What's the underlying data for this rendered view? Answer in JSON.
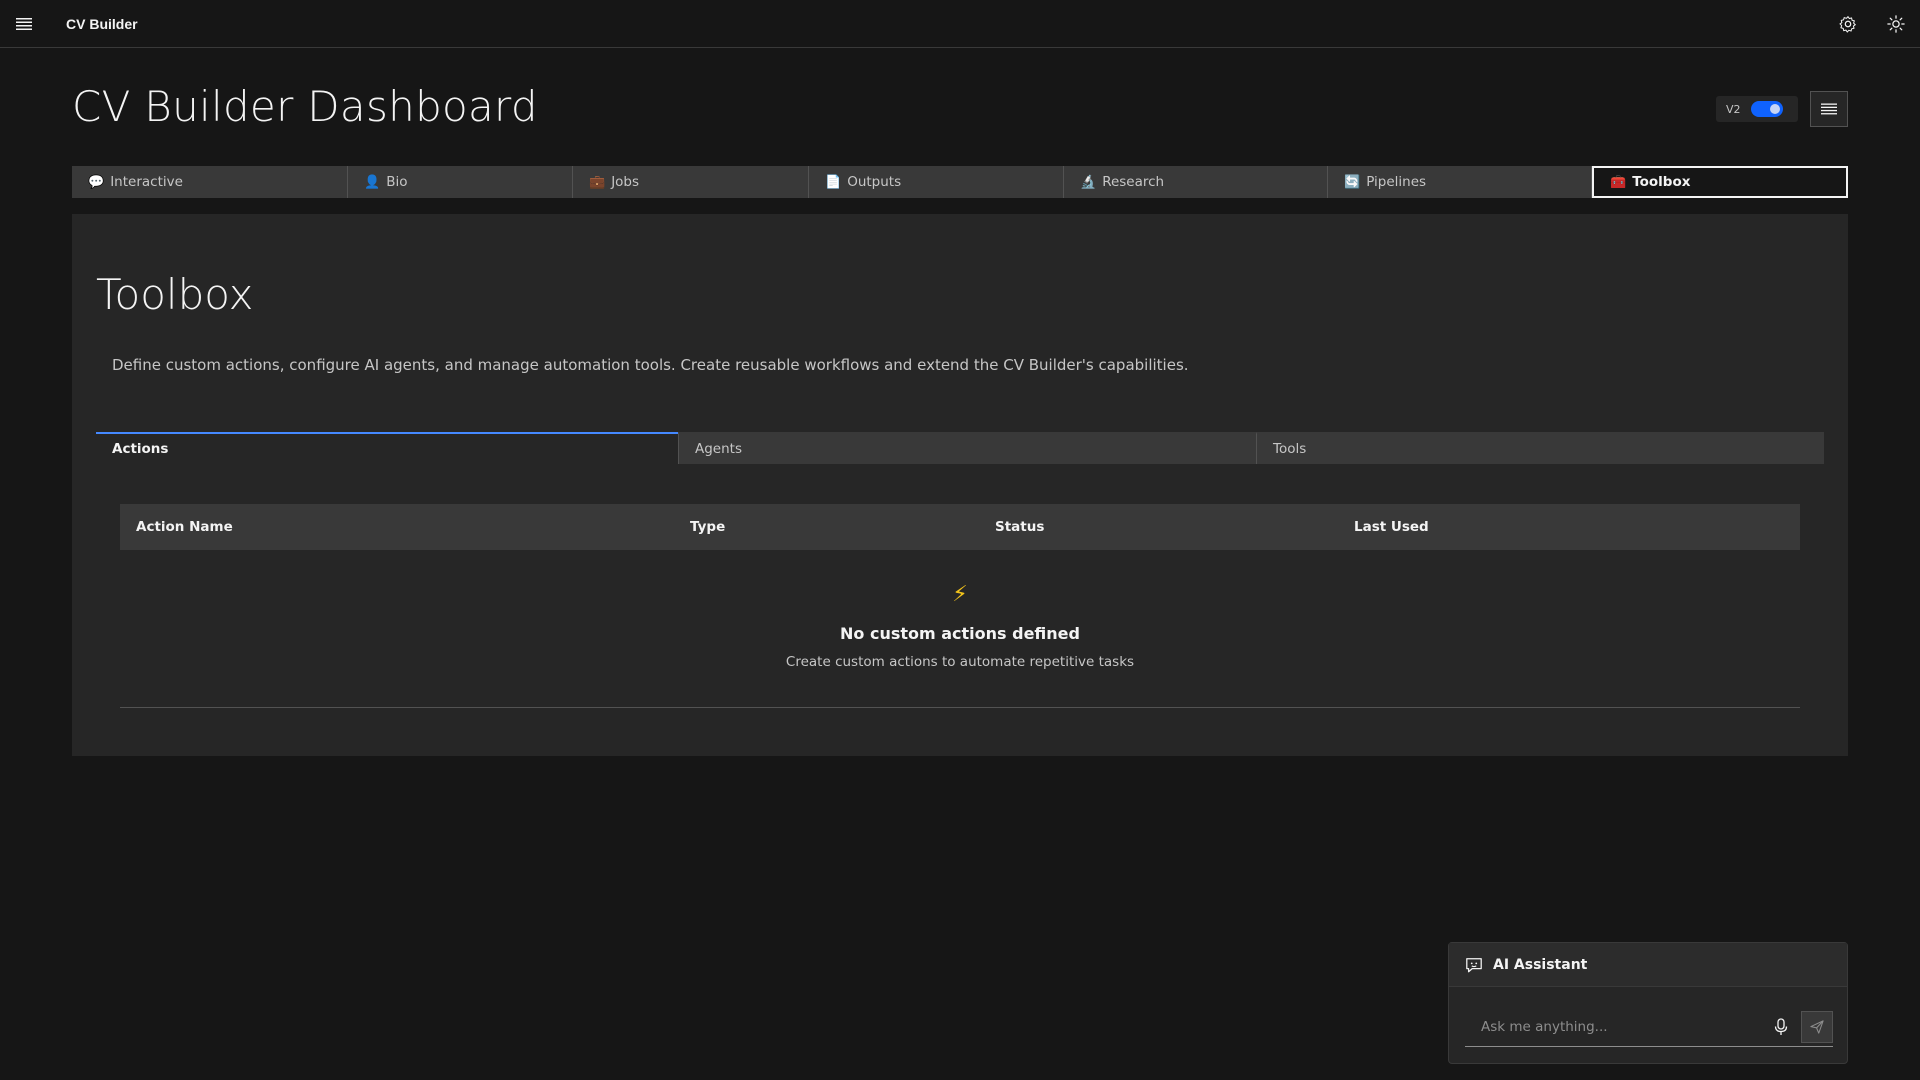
{
  "header": {
    "app_name": "CV Builder",
    "icons": [
      "menu-icon",
      "settings-icon",
      "theme-sun-icon"
    ]
  },
  "page": {
    "title": "CV Builder Dashboard",
    "version_label": "V2",
    "version_enabled": true
  },
  "main_tabs": [
    {
      "emoji": "💬",
      "label": "Interactive"
    },
    {
      "emoji": "👤",
      "label": "Bio"
    },
    {
      "emoji": "💼",
      "label": "Jobs"
    },
    {
      "emoji": "📄",
      "label": "Outputs"
    },
    {
      "emoji": "🔬",
      "label": "Research"
    },
    {
      "emoji": "🔄",
      "label": "Pipelines"
    },
    {
      "emoji": "🧰",
      "label": "Toolbox"
    }
  ],
  "active_main_tab": "Toolbox",
  "toolbox": {
    "title": "Toolbox",
    "description": "Define custom actions, configure AI agents, and manage automation tools. Create reusable workflows and extend the CV Builder's capabilities.",
    "sub_tabs": [
      "Actions",
      "Agents",
      "Tools"
    ],
    "active_sub_tab": "Actions",
    "table": {
      "columns": [
        "Action Name",
        "Type",
        "Status",
        "Last Used"
      ],
      "rows": []
    },
    "empty_state": {
      "icon": "⚡",
      "title": "No custom actions defined",
      "subtitle": "Create custom actions to automate repetitive tasks"
    }
  },
  "assistant": {
    "title": "AI Assistant",
    "placeholder": "Ask me anything..."
  },
  "colors": {
    "background": "#161616",
    "panel": "#262626",
    "accent": "#4589ff",
    "toggle": "#0f62fe",
    "bolt": "#f1c21b"
  }
}
